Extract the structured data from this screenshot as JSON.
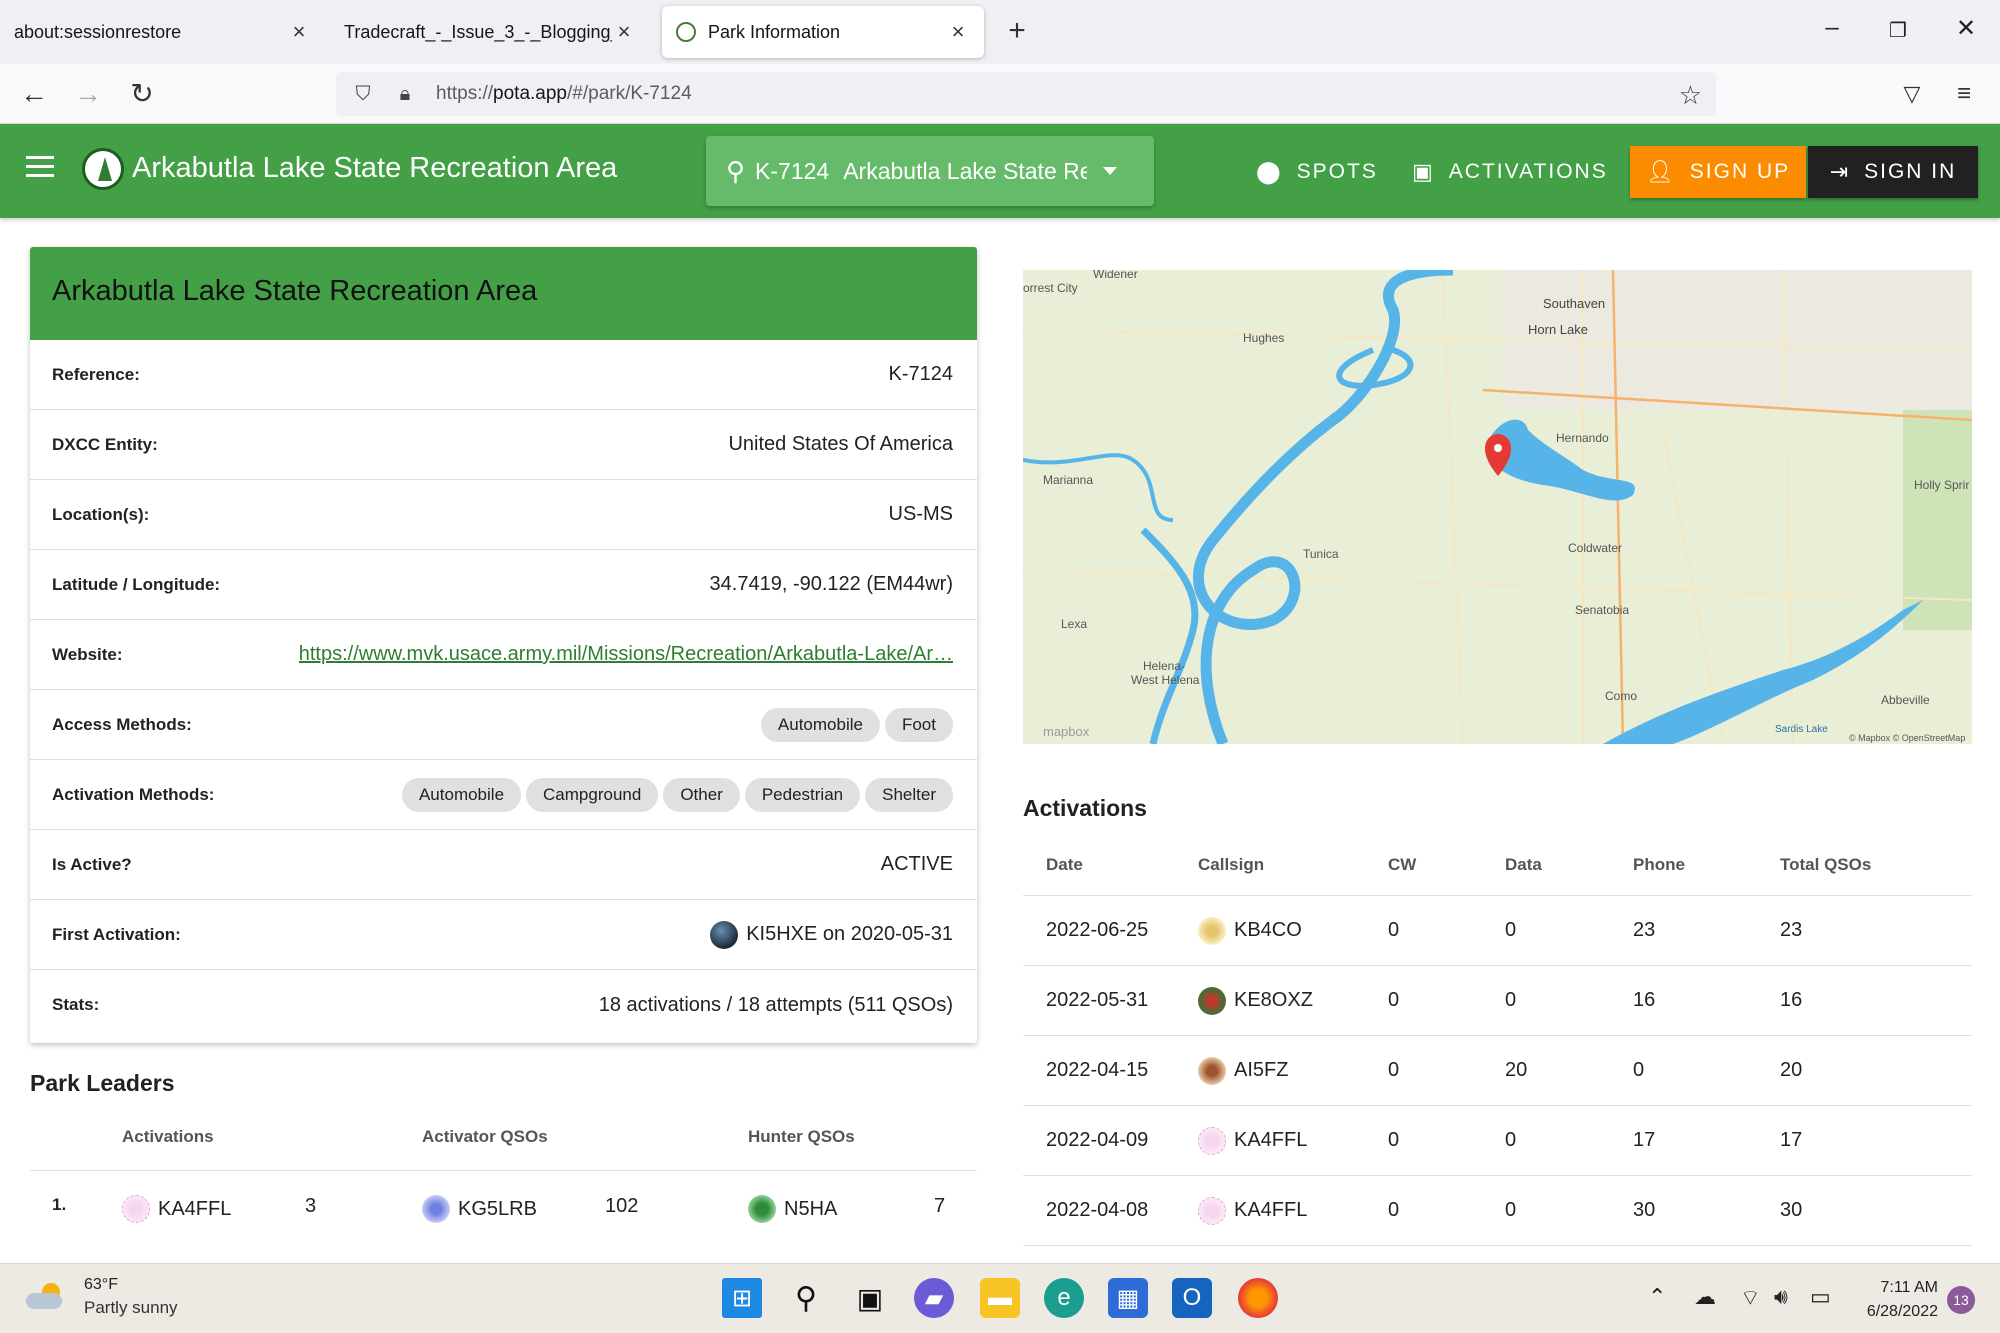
{
  "browser": {
    "tabs": [
      {
        "title": "about:sessionrestore"
      },
      {
        "title": "Tradecraft_-_Issue_3_-_Blogging_101"
      },
      {
        "title": "Park Information"
      }
    ],
    "url_prefix": "https://",
    "url_host": "pota.app",
    "url_path": "/#/park/K-7124"
  },
  "appbar": {
    "title": "Arkabutla Lake State Recreation Area",
    "search_ref": "K-7124",
    "search_name": "Arkabutla Lake State Recreation Area",
    "nav_spots": "SPOTS",
    "nav_activations": "ACTIVATIONS",
    "sign_up": "SIGN UP",
    "sign_in": "SIGN IN"
  },
  "park": {
    "header": "Arkabutla Lake State Recreation Area",
    "reference_label": "Reference:",
    "reference": "K-7124",
    "dxcc_label": "DXCC Entity:",
    "dxcc": "United States Of America",
    "location_label": "Location(s):",
    "location": "US-MS",
    "latlon_label": "Latitude / Longitude:",
    "latlon": "34.7419, -90.122 (EM44wr)",
    "website_label": "Website:",
    "website": "https://www.mvk.usace.army.mil/Missions/Recreation/Arkabutla-Lake/Ar…",
    "access_label": "Access Methods:",
    "access_methods": [
      "Automobile",
      "Foot"
    ],
    "activation_label": "Activation Methods:",
    "activation_methods": [
      "Automobile",
      "Campground",
      "Other",
      "Pedestrian",
      "Shelter"
    ],
    "active_label": "Is Active?",
    "active": "ACTIVE",
    "first_label": "First Activation:",
    "first_activation": "KI5HXE on 2020-05-31",
    "stats_label": "Stats:",
    "stats": "18 activations / 18 attempts (511 QSOs)"
  },
  "leaders": {
    "title": "Park Leaders",
    "col_activations": "Activations",
    "col_activator_qsos": "Activator QSOs",
    "col_hunter_qsos": "Hunter QSOs",
    "rows": [
      {
        "rank": "1.",
        "activator": "KA4FFL",
        "activations": "3",
        "qso_call": "KG5LRB",
        "qsos": "102",
        "hunter": "N5HA",
        "hunter_qsos": "7"
      }
    ]
  },
  "map": {
    "labels": [
      "Widener",
      "orrest City",
      "Hughes",
      "Southaven",
      "Horn Lake",
      "Hernando",
      "Marianna",
      "Holly Sprir",
      "Coldwater",
      "Tunica",
      "Senatobia",
      "Lexa",
      "Helena-",
      "West Helena",
      "Como",
      "Abbeville",
      "Sardis Lake"
    ],
    "attribution": "© Mapbox © OpenStreetMap",
    "brand": "mapbox",
    "water_color": "#57b4e8",
    "marker_color": "#e53935"
  },
  "activations": {
    "title": "Activations",
    "headers": [
      "Date",
      "Callsign",
      "CW",
      "Data",
      "Phone",
      "Total QSOs"
    ],
    "rows": [
      {
        "date": "2022-06-25",
        "callsign": "KB4CO",
        "cw": "0",
        "data": "0",
        "phone": "23",
        "total": "23"
      },
      {
        "date": "2022-05-31",
        "callsign": "KE8OXZ",
        "cw": "0",
        "data": "0",
        "phone": "16",
        "total": "16"
      },
      {
        "date": "2022-04-15",
        "callsign": "AI5FZ",
        "cw": "0",
        "data": "20",
        "phone": "0",
        "total": "20"
      },
      {
        "date": "2022-04-09",
        "callsign": "KA4FFL",
        "cw": "0",
        "data": "0",
        "phone": "17",
        "total": "17"
      },
      {
        "date": "2022-04-08",
        "callsign": "KA4FFL",
        "cw": "0",
        "data": "0",
        "phone": "30",
        "total": "30"
      }
    ]
  },
  "taskbar": {
    "temp": "63°F",
    "weather": "Partly sunny",
    "time": "7:11 AM",
    "date": "6/28/2022",
    "notifications": "13"
  },
  "colors": {
    "primary_green": "#43a047",
    "signup_orange": "#fb8c00",
    "signin_dark": "#212121"
  }
}
